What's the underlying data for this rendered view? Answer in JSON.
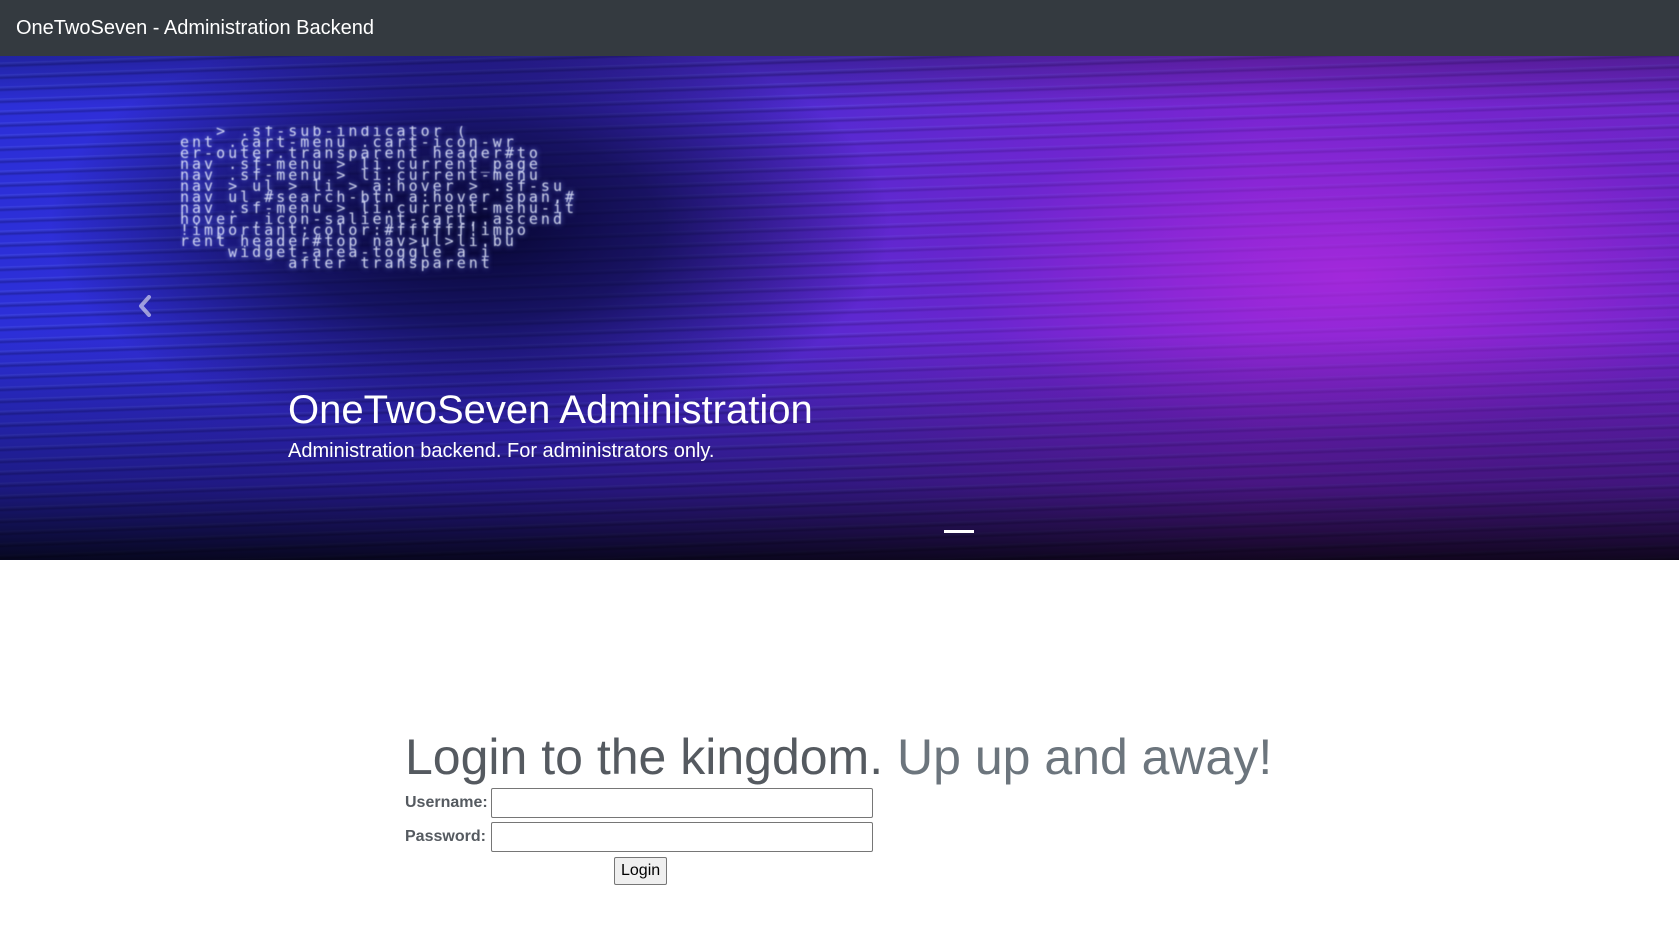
{
  "navbar": {
    "brand": "OneTwoSeven - Administration Backend"
  },
  "carousel": {
    "code_lines": [
      "   > .sf-sub-indicator (",
      "ent .cart-menu .cart-icon-wr",
      "er-outer.transparent header#to",
      "nav .sf-menu > li.current_page",
      "nav .sf-menu > li.current-menu",
      "nav > ul > li > a:hover > .sf-su",
      "nav ul #search-btn a:hover span,#",
      "nav .sf-menu > li.current-menu-it",
      "hover .icon-salient-cart,.ascend",
      "!important;color:#ffffff!impo",
      "rent header#top nav>ul>li.bu",
      "    widget-area-toggle a i",
      "         after transparent"
    ],
    "prev_icon": "chevron-left-icon",
    "caption": {
      "title": "OneTwoSeven Administration",
      "text": "Administration backend. For administrators only."
    }
  },
  "login": {
    "heading_main": "Login to the kingdom.",
    "heading_muted": "Up up and away!",
    "username_label": "Username:",
    "username_value": "",
    "password_label": "Password:",
    "password_value": "",
    "button_label": "Login"
  },
  "colors": {
    "navbar_bg": "#343a40",
    "heading": "#555a60",
    "heading_muted": "#6c757d"
  }
}
